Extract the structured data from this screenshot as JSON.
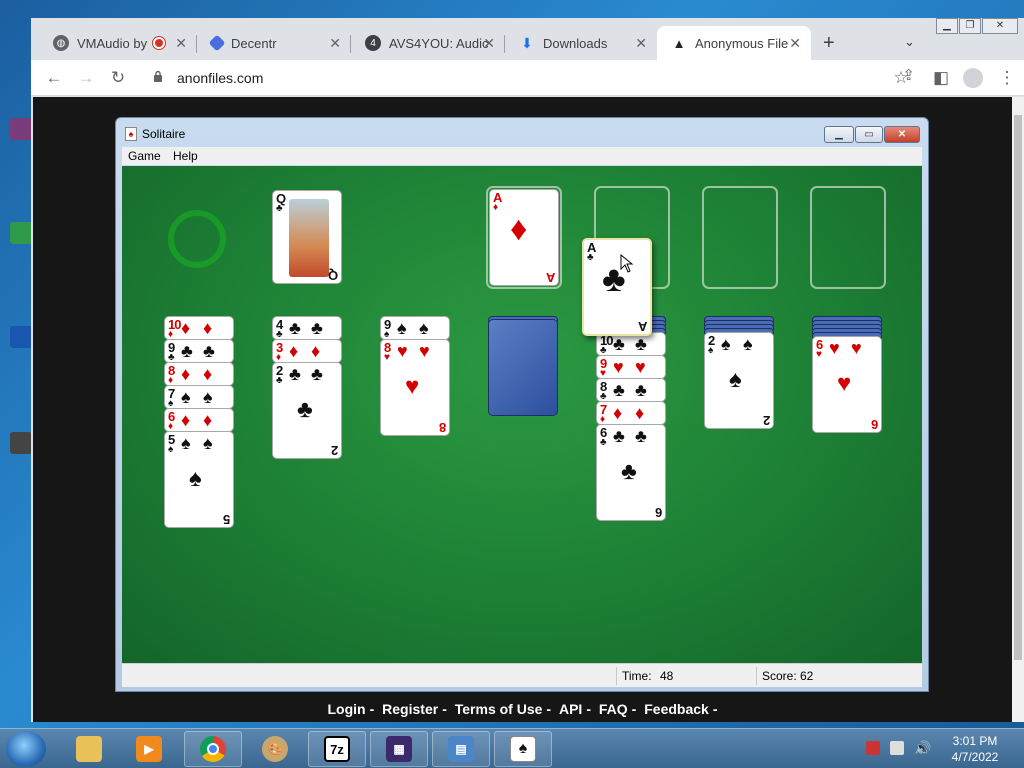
{
  "browser": {
    "tabs": [
      {
        "title": "VMAudio by",
        "icon": "globe-icon",
        "extra": "recording-dot-icon"
      },
      {
        "title": "Decentr",
        "icon": "decentr-icon"
      },
      {
        "title": "AVS4YOU: Audic",
        "icon": "avs4you-icon"
      },
      {
        "title": "Downloads",
        "icon": "download-icon"
      },
      {
        "title": "Anonymous File",
        "icon": "anonfiles-icon",
        "active": true
      }
    ],
    "url": "anonfiles.com",
    "footer_links": [
      "Login",
      "Register",
      "Terms of Use",
      "API",
      "FAQ",
      "Feedback"
    ],
    "footer_sep": "-"
  },
  "solitaire": {
    "title": "Solitaire",
    "menu": [
      "Game",
      "Help"
    ],
    "status": {
      "time_label": "Time:",
      "time_value": "48",
      "score_label": "Score:",
      "score_value": "62"
    },
    "foundation": [
      {
        "rank": "A",
        "suit": "♦",
        "color": "red"
      },
      null,
      null,
      null
    ],
    "waste_top": {
      "rank": "Q",
      "suit": "♣",
      "color": "black"
    },
    "dragging": {
      "rank": "A",
      "suit": "♣",
      "color": "black"
    },
    "tableau": [
      {
        "hidden": 0,
        "cards": [
          {
            "rank": "10",
            "suit": "♦",
            "color": "red"
          },
          {
            "rank": "9",
            "suit": "♣",
            "color": "black"
          },
          {
            "rank": "8",
            "suit": "♦",
            "color": "red"
          },
          {
            "rank": "7",
            "suit": "♠",
            "color": "black"
          },
          {
            "rank": "6",
            "suit": "♦",
            "color": "red"
          },
          {
            "rank": "5",
            "suit": "♠",
            "color": "black"
          }
        ]
      },
      {
        "hidden": 0,
        "cards": [
          {
            "rank": "4",
            "suit": "♣",
            "color": "black"
          },
          {
            "rank": "3",
            "suit": "♦",
            "color": "red"
          },
          {
            "rank": "2",
            "suit": "♣",
            "color": "black"
          }
        ]
      },
      {
        "hidden": 0,
        "cards": [
          {
            "rank": "9",
            "suit": "♠",
            "color": "black"
          },
          {
            "rank": "8",
            "suit": "♥",
            "color": "red"
          }
        ]
      },
      {
        "hidden": 2,
        "cards": []
      },
      {
        "hidden": 4,
        "cards": [
          {
            "rank": "10",
            "suit": "♣",
            "color": "black"
          },
          {
            "rank": "9",
            "suit": "♥",
            "color": "red"
          },
          {
            "rank": "8",
            "suit": "♣",
            "color": "black"
          },
          {
            "rank": "7",
            "suit": "♦",
            "color": "red"
          },
          {
            "rank": "6",
            "suit": "♣",
            "color": "black"
          }
        ]
      },
      {
        "hidden": 4,
        "cards": [
          {
            "rank": "2",
            "suit": "♠",
            "color": "black"
          }
        ]
      },
      {
        "hidden": 5,
        "cards": [
          {
            "rank": "6",
            "suit": "♥",
            "color": "red"
          }
        ]
      }
    ]
  },
  "taskbar": {
    "apps": [
      "windows-explorer-icon",
      "media-player-icon",
      "chrome-icon",
      "paint-icon",
      "7zip-icon",
      "video-editor-icon",
      "remote-desktop-icon",
      "solitaire-icon"
    ],
    "seven_zip_label": "7z",
    "time": "3:01 PM",
    "date": "4/7/2022"
  }
}
